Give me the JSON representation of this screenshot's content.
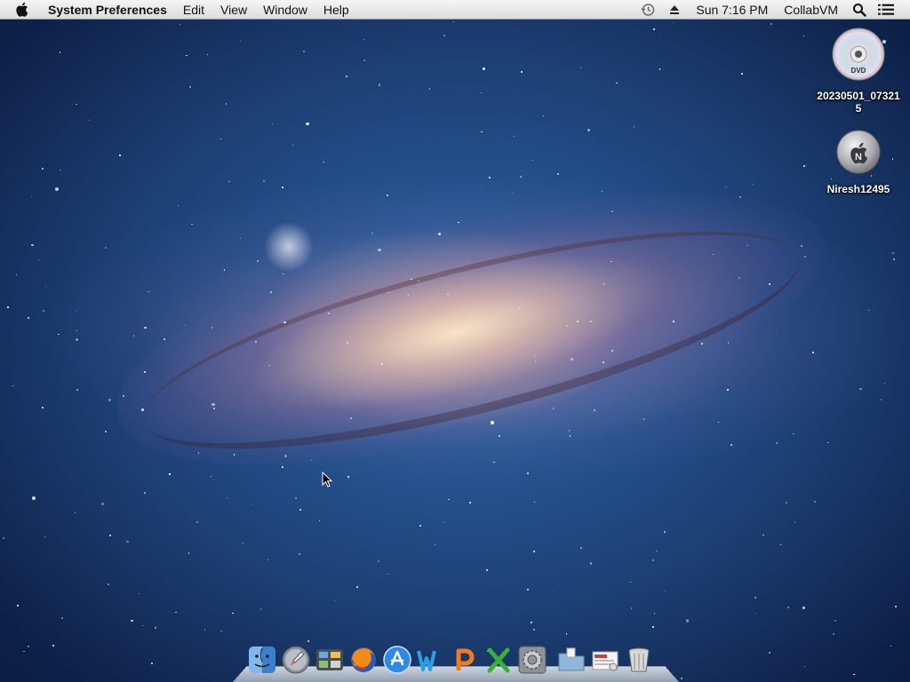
{
  "menubar": {
    "apple_icon": "apple-logo-icon",
    "app_name": "System Preferences",
    "menus": [
      "Edit",
      "View",
      "Window",
      "Help"
    ],
    "status": {
      "time_machine_icon": "time-machine-icon",
      "eject_icon": "eject-icon",
      "clock": "Sun 7:16 PM",
      "user": "CollabVM",
      "spotlight_icon": "spotlight-icon",
      "notification_icon": "list-icon"
    }
  },
  "desktop_icons": [
    {
      "label": "20230501_073215",
      "icon": "dvd-disc-icon"
    },
    {
      "label": "Niresh12495",
      "icon": "apple-disk-icon"
    }
  ],
  "dock": {
    "apps": [
      {
        "name": "Finder",
        "icon": "finder-icon"
      },
      {
        "name": "Launchpad",
        "icon": "launchpad-icon"
      },
      {
        "name": "Mission Control",
        "icon": "mission-control-icon"
      },
      {
        "name": "Firefox",
        "icon": "firefox-icon"
      },
      {
        "name": "App Store",
        "icon": "app-store-icon"
      },
      {
        "name": "Word",
        "icon": "word-icon"
      },
      {
        "name": "PowerPoint",
        "icon": "powerpoint-icon"
      },
      {
        "name": "Excel",
        "icon": "excel-icon"
      },
      {
        "name": "System Preferences",
        "icon": "system-preferences-icon"
      }
    ],
    "others": [
      {
        "name": "Applications",
        "icon": "applications-folder-icon"
      },
      {
        "name": "Documents",
        "icon": "documents-stack-icon"
      },
      {
        "name": "Trash",
        "icon": "trash-icon"
      }
    ]
  },
  "colors": {
    "menubar_bg": "#e6e6e6",
    "sky_dark": "#0c1f45",
    "sky_mid": "#2f66a8",
    "galaxy_core": "#ffebc8"
  }
}
